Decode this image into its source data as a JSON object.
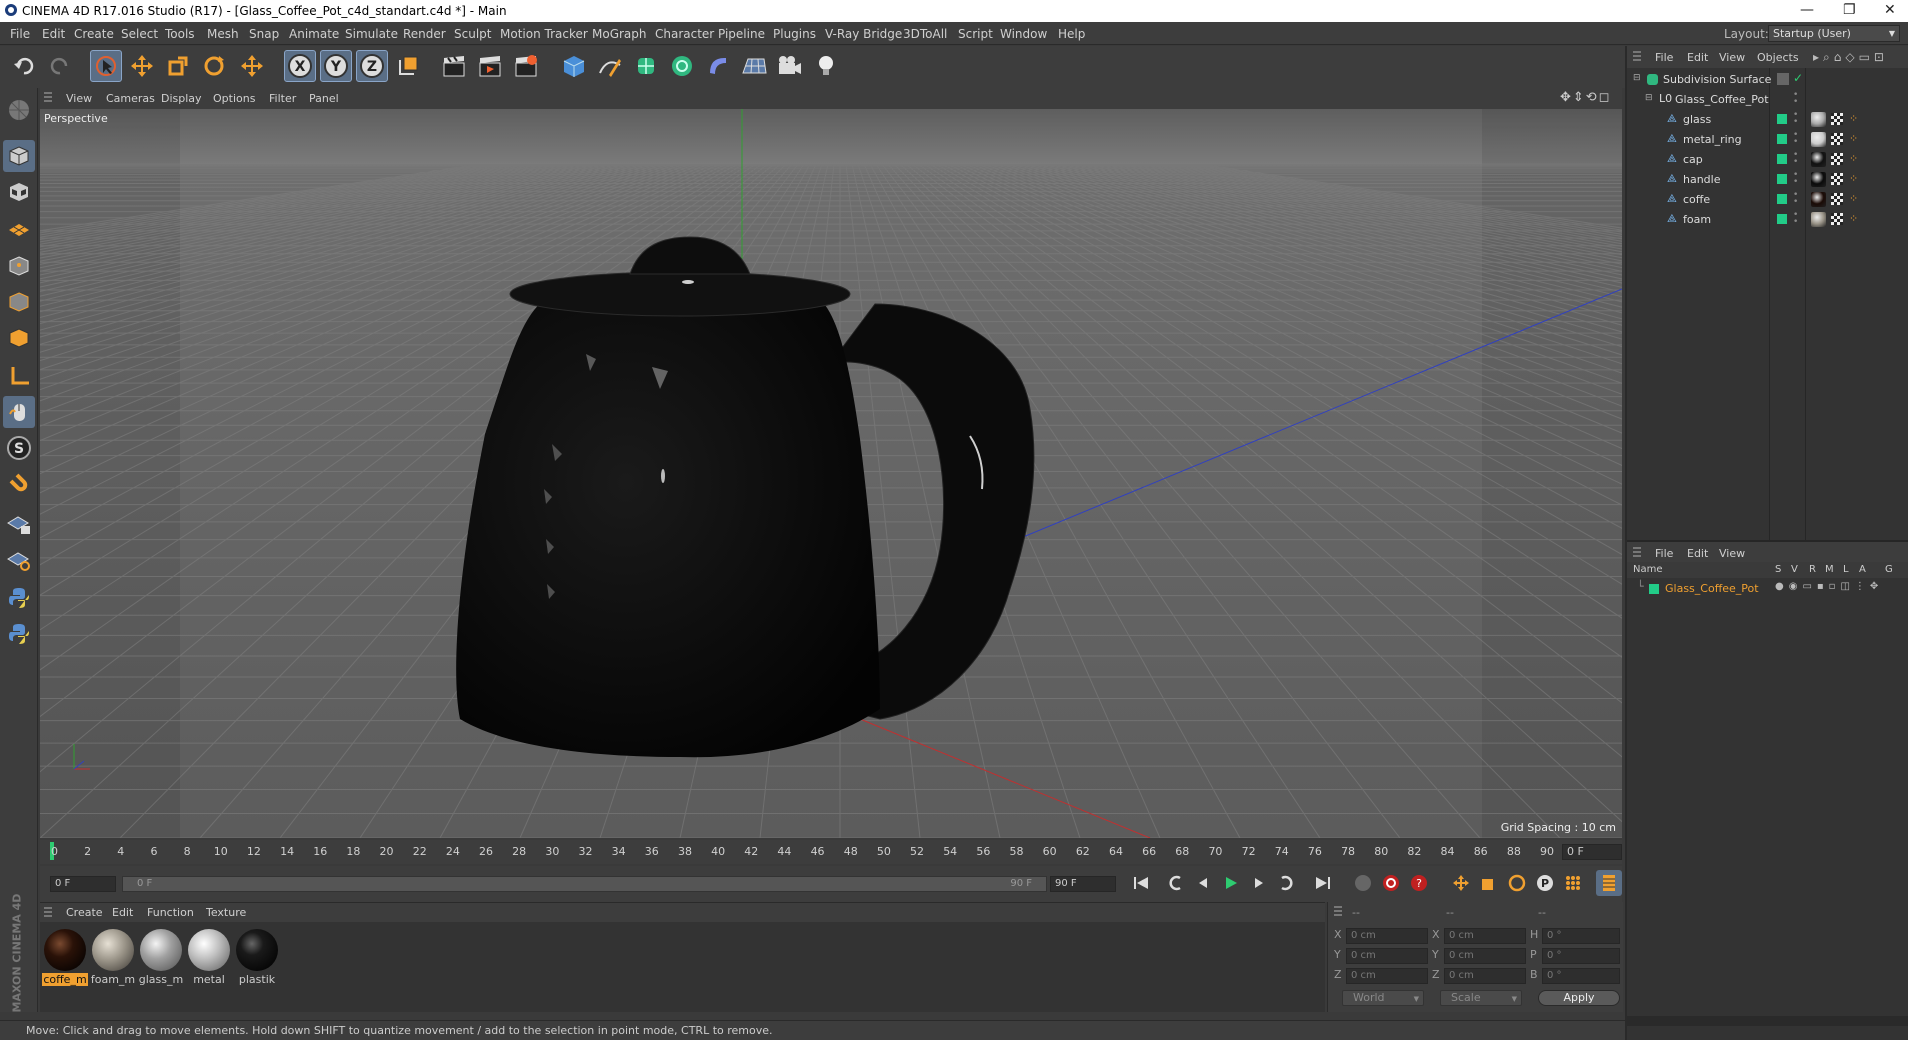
{
  "window": {
    "title": "CINEMA 4D R17.016 Studio (R17) - [Glass_Coffee_Pot_c4d_standart.c4d *] - Main"
  },
  "menu": [
    "File",
    "Edit",
    "Create",
    "Select",
    "Tools",
    "Mesh",
    "Snap",
    "Animate",
    "Simulate",
    "Render",
    "Sculpt",
    "Motion Tracker",
    "MoGraph",
    "Character",
    "Pipeline",
    "Plugins",
    "V-Ray Bridge",
    "3DToAll",
    "Script",
    "Window",
    "Help"
  ],
  "layout": {
    "label": "Layout:",
    "value": "Startup (User)"
  },
  "viewport": {
    "menu": [
      "View",
      "Cameras",
      "Display",
      "Options",
      "Filter",
      "Panel"
    ],
    "label": "Perspective",
    "grid_spacing": "Grid Spacing : 10 cm"
  },
  "timeline": {
    "ticks": [
      "0",
      "2",
      "4",
      "6",
      "8",
      "10",
      "12",
      "14",
      "16",
      "18",
      "20",
      "22",
      "24",
      "26",
      "28",
      "30",
      "32",
      "34",
      "36",
      "38",
      "40",
      "42",
      "44",
      "46",
      "48",
      "50",
      "52",
      "54",
      "56",
      "58",
      "60",
      "62",
      "64",
      "66",
      "68",
      "70",
      "72",
      "74",
      "76",
      "78",
      "80",
      "82",
      "84",
      "86",
      "88",
      "90"
    ],
    "current_frame": "0 F"
  },
  "playback": {
    "start": "0 F",
    "range_start": "0 F",
    "range_end": "90 F",
    "end": "90 F"
  },
  "materials": {
    "menu": [
      "Create",
      "Edit",
      "Function",
      "Texture"
    ],
    "items": [
      {
        "label": "coffe_m",
        "color": "#2a1208",
        "selected": true
      },
      {
        "label": "foam_m",
        "color": "#9a9488",
        "selected": false
      },
      {
        "label": "glass_m",
        "color": "#8e8e8e",
        "selected": false
      },
      {
        "label": "metal",
        "color": "#b8b8b8",
        "selected": false
      },
      {
        "label": "plastik",
        "color": "#111111",
        "selected": false
      }
    ]
  },
  "coords": {
    "rows": [
      {
        "a": "X",
        "av": "0 cm",
        "b": "X",
        "bv": "0 cm",
        "c": "H",
        "cv": "0 °"
      },
      {
        "a": "Y",
        "av": "0 cm",
        "b": "Y",
        "bv": "0 cm",
        "c": "P",
        "cv": "0 °"
      },
      {
        "a": "Z",
        "av": "0 cm",
        "b": "Z",
        "bv": "0 cm",
        "c": "B",
        "cv": "0 °"
      }
    ],
    "headers": [
      "--",
      "--",
      "--"
    ],
    "mode": "World",
    "type": "Scale",
    "apply": "Apply"
  },
  "status": "Move: Click and drag to move elements. Hold down SHIFT to quantize movement / add to the selection in point mode, CTRL to remove.",
  "object_manager": {
    "menu": [
      "File",
      "Edit",
      "View",
      "Objects"
    ],
    "root": "Subdivision Surface",
    "group": "Glass_Coffee_Pot",
    "children": [
      "glass",
      "metal_ring",
      "cap",
      "handle",
      "coffe",
      "foam"
    ]
  },
  "layer_manager": {
    "menu": [
      "File",
      "Edit",
      "View"
    ],
    "columns": [
      "Name",
      "S",
      "V",
      "R",
      "M",
      "L",
      "A",
      "G"
    ],
    "item": "Glass_Coffee_Pot"
  },
  "brand": "MAXON CINEMA 4D",
  "colors": {
    "accent_orange": "#f0a030",
    "active_green": "#22cc88",
    "axis_x": "#c03030",
    "axis_y": "#30a030",
    "axis_z": "#3040c0"
  }
}
